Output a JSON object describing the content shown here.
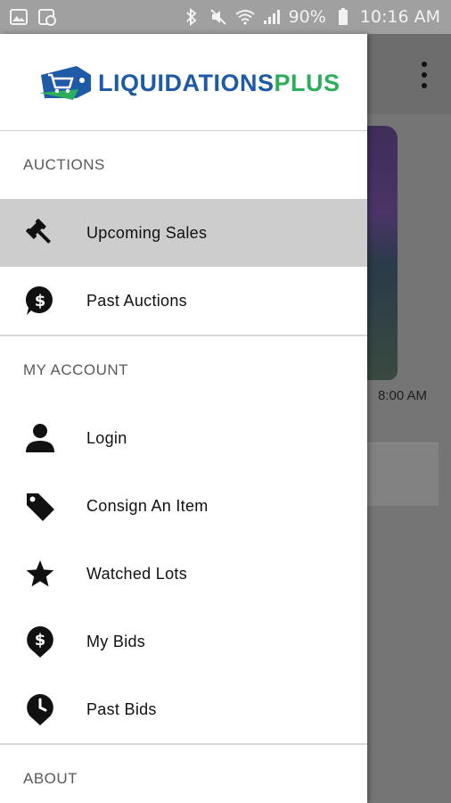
{
  "status_bar": {
    "battery": "90%",
    "time": "10:16 AM"
  },
  "background": {
    "event_time": "8:00 AM"
  },
  "logo": {
    "part1": "LIQUIDATIONS",
    "part2": "PLUS"
  },
  "drawer": {
    "sections": [
      {
        "title": "AUCTIONS",
        "items": [
          {
            "label": "Upcoming Sales",
            "icon": "gavel-icon",
            "active": true
          },
          {
            "label": "Past Auctions",
            "icon": "dollar-bubble-icon",
            "active": false
          }
        ]
      },
      {
        "title": "MY ACCOUNT",
        "items": [
          {
            "label": "Login",
            "icon": "person-icon"
          },
          {
            "label": "Consign An Item",
            "icon": "tag-icon"
          },
          {
            "label": "Watched Lots",
            "icon": "star-icon"
          },
          {
            "label": "My Bids",
            "icon": "dollar-pin-icon"
          },
          {
            "label": "Past Bids",
            "icon": "clock-pin-icon"
          }
        ]
      },
      {
        "title": "ABOUT",
        "items": []
      }
    ]
  },
  "colors": {
    "brand_blue": "#1f5aa6",
    "brand_green": "#2eae5d",
    "active_row": "#cdcdcd"
  }
}
